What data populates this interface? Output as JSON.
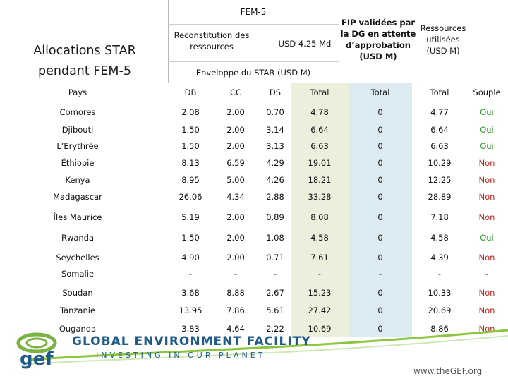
{
  "header": {
    "left_title": "Allocations STAR pendant FEM-5",
    "left_title_line1": "Allocations STAR",
    "left_title_line2": "pendant FEM-5",
    "fem5": "FEM-5",
    "reconstitution": "Reconstitution des ressources",
    "reconstitution_line1": "Reconstitution des",
    "reconstitution_line2": "ressources",
    "usd_amount": "USD 4.25 Md",
    "envelope": "Enveloppe du STAR (USD M)",
    "fip_line1": "FIP validées par",
    "fip_line2": "la DG en attente",
    "fip_line3": "d’approbation",
    "fip_line4": "(USD M)",
    "res_line1": "Ressources",
    "res_line2": "utilisées",
    "res_line3": "(USD M)"
  },
  "columns": {
    "pays": "Pays",
    "db": "DB",
    "cc": "CC",
    "ds": "DS",
    "total1": "Total",
    "total2": "Total",
    "total3": "Total",
    "souple": "Souple"
  },
  "rows": [
    {
      "pays": "Comores",
      "db": "2.08",
      "cc": "2.00",
      "ds": "0.70",
      "total": "4.78",
      "fip": "0",
      "used": "4.77",
      "souple": "Oui"
    },
    {
      "pays": "Djibouti",
      "db": "1.50",
      "cc": "2.00",
      "ds": "3.14",
      "total": "6.64",
      "fip": "0",
      "used": "6.64",
      "souple": "Oui"
    },
    {
      "pays": "L’Erythrée",
      "db": "1.50",
      "cc": "2.00",
      "ds": "3.13",
      "total": "6.63",
      "fip": "0",
      "used": "6.63",
      "souple": "Oui"
    },
    {
      "pays": "Éthiopie",
      "db": "8.13",
      "cc": "6.59",
      "ds": "4.29",
      "total": "19.01",
      "fip": "0",
      "used": "10.29",
      "souple": "Non"
    },
    {
      "pays": "Kenya",
      "db": "8.95",
      "cc": "5.00",
      "ds": "4.26",
      "total": "18.21",
      "fip": "0",
      "used": "12.25",
      "souple": "Non"
    },
    {
      "pays": "Madagascar",
      "db": "26.06",
      "cc": "4.34",
      "ds": "2.88",
      "total": "33.28",
      "fip": "0",
      "used": "28.89",
      "souple": "Non"
    },
    {
      "pays": "Îles Maurice",
      "db": "5.19",
      "cc": "2.00",
      "ds": "0.89",
      "total": "8.08",
      "fip": "0",
      "used": "7.18",
      "souple": "Non"
    },
    {
      "pays": "Rwanda",
      "db": "1.50",
      "cc": "2.00",
      "ds": "1.08",
      "total": "4.58",
      "fip": "0",
      "used": "4.58",
      "souple": "Oui"
    },
    {
      "pays": "Seychelles",
      "db": "4.90",
      "cc": "2.00",
      "ds": "0.71",
      "total": "7.61",
      "fip": "0",
      "used": "4.39",
      "souple": "Non"
    },
    {
      "pays": "Somalie",
      "db": "-",
      "cc": "-",
      "ds": "-",
      "total": "-",
      "fip": "-",
      "used": "-",
      "souple": "-"
    },
    {
      "pays": "Soudan",
      "db": "3.68",
      "cc": "8.88",
      "ds": "2.67",
      "total": "15.23",
      "fip": "0",
      "used": "10.33",
      "souple": "Non"
    },
    {
      "pays": "Tanzanie",
      "db": "13.95",
      "cc": "7.86",
      "ds": "5.61",
      "total": "27.42",
      "fip": "0",
      "used": "20.69",
      "souple": "Non"
    },
    {
      "pays": "Ouganda",
      "db": "3.83",
      "cc": "4.64",
      "ds": "2.22",
      "total": "10.69",
      "fip": "0",
      "used": "8.86",
      "souple": "Non"
    }
  ],
  "footer": {
    "logo_text": "gef",
    "org_line1": "GLOBAL ENVIRONMENT FACILITY",
    "org_line2": "INVESTING IN OUR PLANET",
    "url": "www.theGEF.org"
  },
  "colors": {
    "oui": "#2e9a2e",
    "non": "#c0201a",
    "total_bg": "#ebf0dc",
    "fip_bg": "#dcebf1",
    "gef_green": "#7bb342",
    "gef_blue": "#1f5a8a"
  }
}
